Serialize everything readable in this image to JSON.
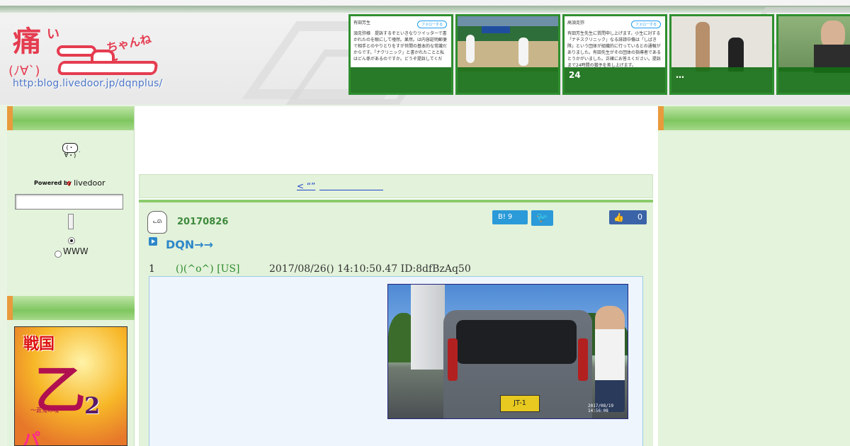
{
  "header": {
    "logo": {
      "kanji": "痛",
      "small": "い",
      "channel": "ちゃんねる",
      "face": "(ﾉ∀`)",
      "url": "http:blog.livedoor.jp/dqnplus/"
    },
    "thumbs": [
      {
        "caption": "",
        "tweet_author": "有田芳生",
        "follow": "フォローする",
        "text": "須克弥様　提訴するぞといきなりツイッターで書かれたのを眼にして唖然。果然。は内容証明郵便で相手とのやりとりをすが世間の基本的な常識だからです。「ナクリニック」と書かれたことと私はどん係があるのですか。どうぞ提訴してくだ"
      },
      {
        "caption": "",
        "scene": "baseball"
      },
      {
        "caption": "24",
        "tweet_author": "高須克弥",
        "follow": "フォローする",
        "text": "有田芳生先生に質問申し上げます。小生に対する「ナチスクリニック」なる誹謗中傷は「しばき隊」という団体が組織的に行っているとの通報がありました。有田先生がその団体の指導者であるとうかがいました。正確にお答えください。提訴まで24時間の猶予を差し上げます。"
      },
      {
        "caption": "…",
        "scene": "couple"
      },
      {
        "caption": "",
        "scene": "group"
      }
    ]
  },
  "sidebar": {
    "face": "(・∀・)",
    "face_dot": ".",
    "powered_by": "Powered by",
    "livedoor": "livedoor",
    "search_value": "",
    "radio_www": "WWW",
    "ad": {
      "title": "戦国",
      "main": "乙",
      "num": "2",
      "sub": "～蒼鬼の魂～",
      "corner": "パ"
    }
  },
  "center": {
    "nav_link": "< “”",
    "date": "20170826",
    "share": {
      "hatena_label": "B!",
      "hatena_count": "9",
      "twitter": "🐦",
      "fb_icon": "👍",
      "fb_count": "0"
    },
    "title": "DQN→→",
    "post": {
      "num": "1",
      "name": "()(^o^) [US]",
      "meta": "2017/08/26() 14:10:50.47 ID:8dfBzAq50"
    },
    "photo": {
      "plate": "JT-1",
      "stamp": "2017/08/19 14:56:08"
    }
  },
  "colors": {
    "accent_green": "#8bcc6d",
    "link_blue": "#2244cc",
    "title_blue": "#2d87c9",
    "logo_red": "#e53c50"
  }
}
